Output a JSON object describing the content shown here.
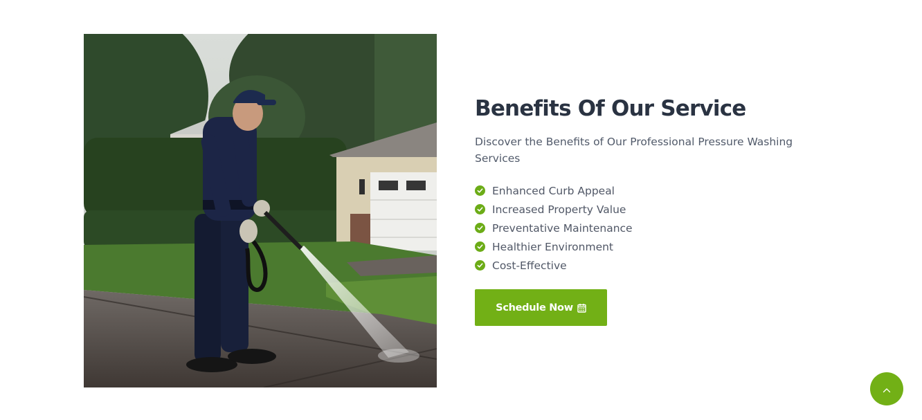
{
  "section": {
    "title": "Benefits Of Our Service",
    "subtitle": "Discover the Benefits of Our Professional Pressure Washing Services"
  },
  "benefits": [
    "Enhanced Curb Appeal",
    "Increased Property Value",
    "Preventative Maintenance",
    "Healthier Environment",
    "Cost-Effective"
  ],
  "cta": {
    "label": "Schedule Now",
    "icon": "calendar-icon"
  },
  "scroll_top": {
    "icon": "chevron-up-icon"
  },
  "icons": {
    "benefit_marker": "check-circle-icon"
  },
  "colors": {
    "accent": "#72b016",
    "heading": "#2a3342",
    "body_text": "#515a6a"
  }
}
